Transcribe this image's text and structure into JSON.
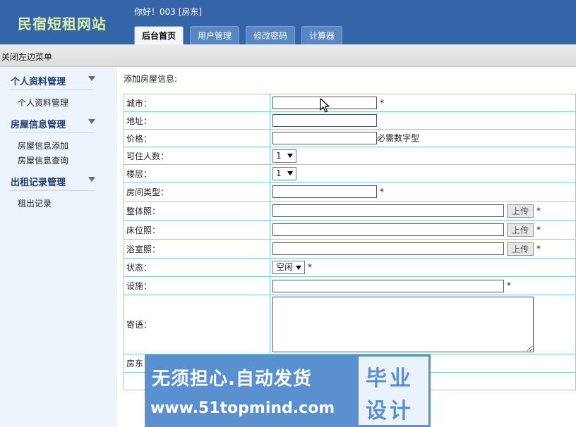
{
  "header": {
    "site_title": "民宿短租网站",
    "greeting": "你好！003 [房东]",
    "tabs": [
      {
        "label": "后台首页",
        "active": true
      },
      {
        "label": "用户管理",
        "active": false
      },
      {
        "label": "修改密码",
        "active": false
      },
      {
        "label": "计算器",
        "active": false
      }
    ],
    "colors": {
      "header_bg": "#3565a8",
      "title": "#d7f0a8"
    }
  },
  "menu_bar": {
    "toggle_label": "关闭左边菜单"
  },
  "sidebar": {
    "groups": [
      {
        "title": "个人资料管理",
        "items": [
          "个人资料管理"
        ]
      },
      {
        "title": "房屋信息管理",
        "items": [
          "房屋信息添加",
          "房屋信息查询"
        ]
      },
      {
        "title": "出租记录管理",
        "items": [
          "租出记录"
        ]
      }
    ]
  },
  "main": {
    "heading": "添加房屋信息:",
    "form": {
      "city_label": "城市：",
      "address_label": "地址：",
      "price_label": "价格：",
      "price_hint": "必需数字型",
      "capacity_label": "可住人数：",
      "capacity_value": "1",
      "floor_label": "楼层：",
      "floor_value": "1",
      "room_type_label": "房间类型：",
      "whole_photo_label": "整体照：",
      "bed_photo_label": "床位照：",
      "bath_photo_label": "浴室照：",
      "status_label": "状态：",
      "status_value": "空闲",
      "facility_label": "设施：",
      "message_label": "寄语：",
      "owner_label": "房东",
      "upload_label": "上传",
      "required_mark": "*"
    }
  },
  "watermark": {
    "line1": "无须担心.自动发货",
    "line2": "www.51topmind.com",
    "box_line1": "毕业",
    "box_line2": "设计",
    "color": "#5a8fd0"
  },
  "icons": {
    "collapse_arrow": "triangle-down-icon",
    "cursor": "mouse-pointer-icon"
  }
}
